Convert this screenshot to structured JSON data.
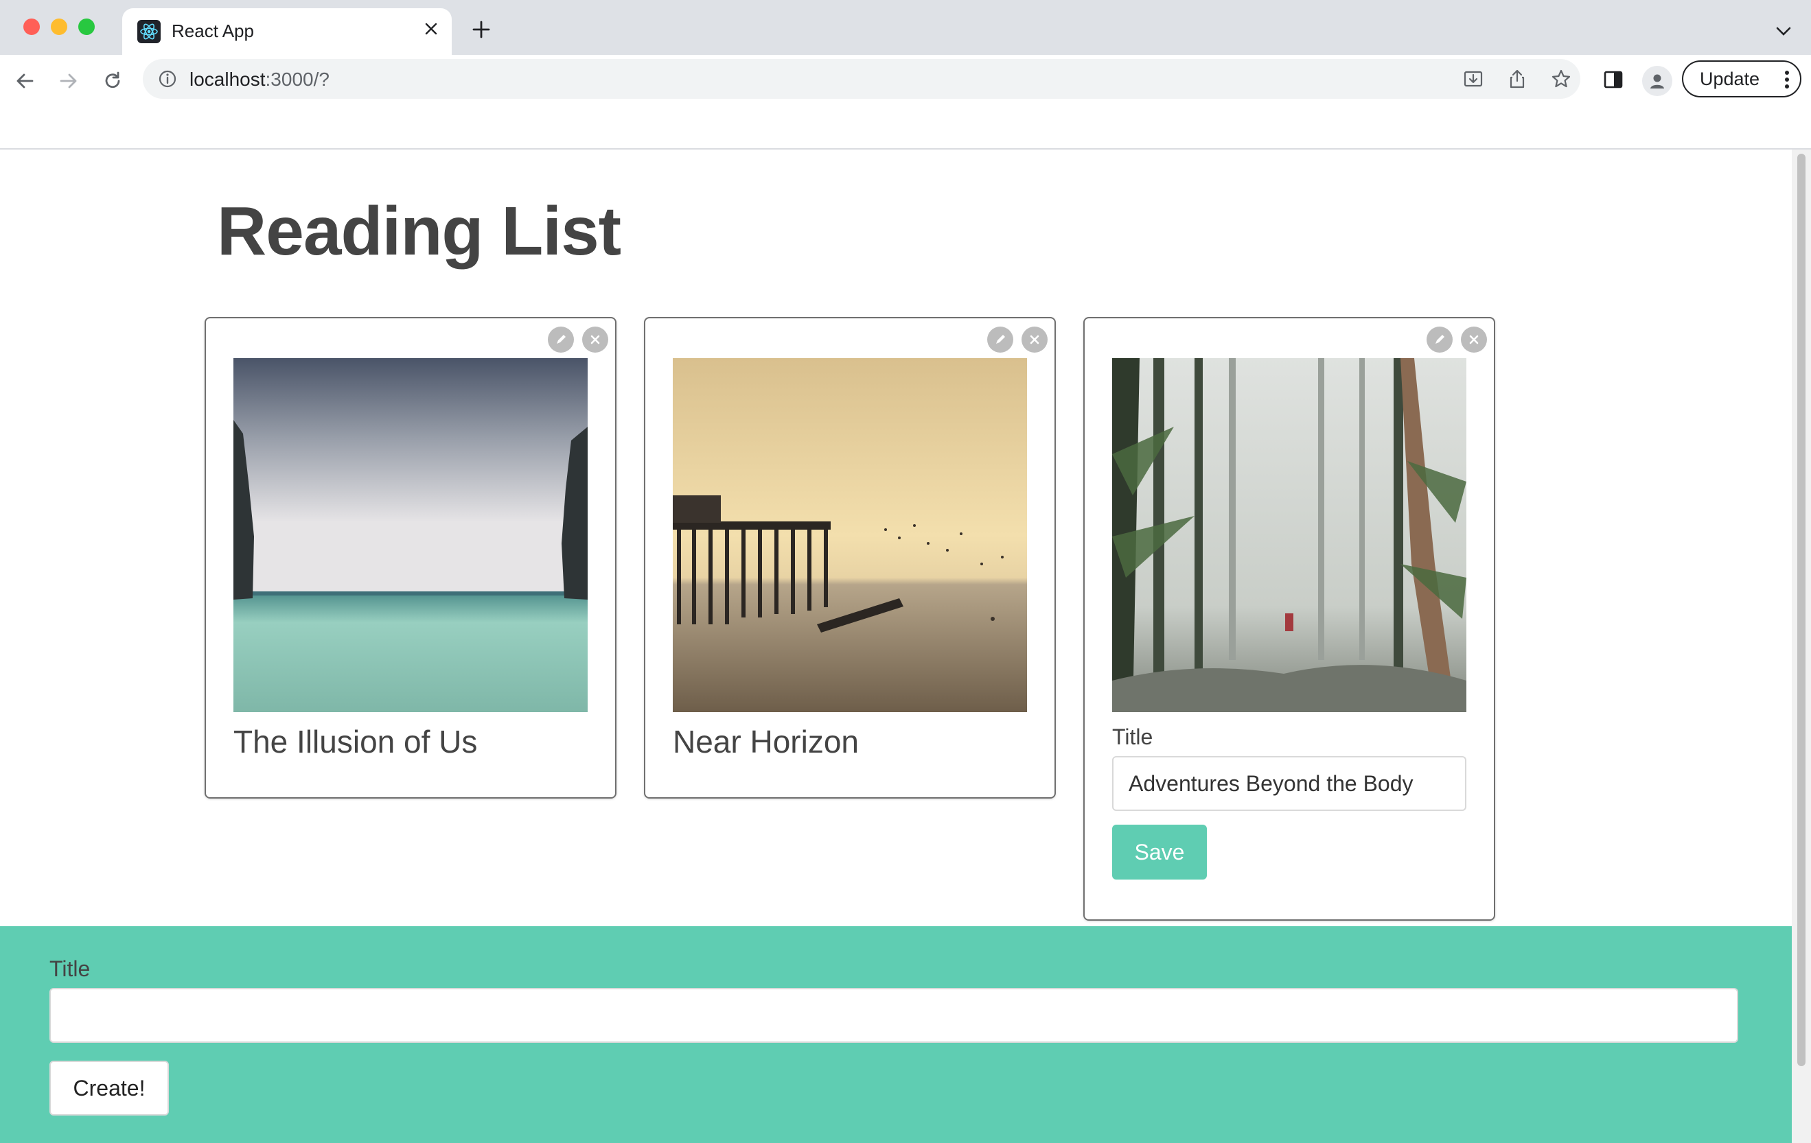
{
  "browser": {
    "tab_title": "React App",
    "url_host": "localhost",
    "url_rest": ":3000/?",
    "update_label": "Update"
  },
  "page": {
    "title": "Reading List"
  },
  "books": [
    {
      "title": "The Illusion of Us",
      "image": "sea-cliffs-image"
    },
    {
      "title": "Near Horizon",
      "image": "pier-sunset-image"
    },
    {
      "title": "Adventures Beyond the Body",
      "image": "misty-forest-image",
      "editing": true
    }
  ],
  "edit_form": {
    "label": "Title",
    "value": "Adventures Beyond the Body",
    "save_label": "Save"
  },
  "create_form": {
    "label": "Title",
    "value": "",
    "button_label": "Create!"
  },
  "colors": {
    "accent": "#5fcdb2",
    "text": "#444444",
    "card_border": "#6f6f6f",
    "icon_circle": "#bcbcbc"
  }
}
